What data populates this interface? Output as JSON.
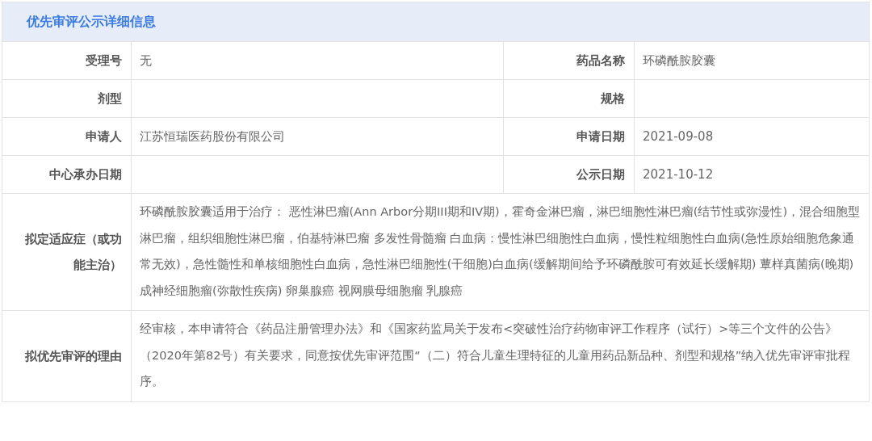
{
  "title": "优先审评公示详细信息",
  "pair_rows": [
    {
      "fields": [
        {
          "label": "受理号",
          "value": "无"
        },
        {
          "label": "药品名称",
          "value": "环磷酰胺胶囊"
        }
      ]
    },
    {
      "fields": [
        {
          "label": "剂型"
        },
        {
          "label": "规格"
        }
      ]
    },
    {
      "fields": [
        {
          "label": "申请人",
          "value": "江苏恒瑞医药股份有限公司"
        },
        {
          "label": "申请日期",
          "value": "2021-09-08"
        }
      ]
    },
    {
      "fields": [
        {
          "label": "中心承办日期"
        },
        {
          "label": "公示日期",
          "value": "2021-10-12"
        }
      ]
    }
  ],
  "long_rows": [
    {
      "label": "拟定适应症（或功能主治）",
      "value": "环磷酰胺胶囊适用于治疗： 恶性淋巴瘤(Ann Arbor分期III期和IV期)，霍奇金淋巴瘤，淋巴细胞性淋巴瘤(结节性或弥漫性)，混合细胞型淋巴瘤，组织细胞性淋巴瘤，伯基特淋巴瘤 多发性骨髓瘤 白血病：慢性淋巴细胞性白血病，慢性粒细胞性白血病(急性原始细胞危象通常无效)，急性髓性和单核细胞性白血病，急性淋巴细胞性(干细胞)白血病(缓解期间给予环磷酰胺可有效延长缓解期) 蕈样真菌病(晚期) 成神经细胞瘤(弥散性疾病) 卵巢腺癌 视网膜母细胞瘤 乳腺癌"
    },
    {
      "label": "拟优先审评的理由",
      "value": "经审核，本申请符合《药品注册管理办法》和《国家药监局关于发布<突破性治疗药物审评工作程序（试行）>等三个文件的公告》（2020年第82号）有关要求，同意按优先审评范围“（二）符合儿童生理特征的儿童用药品新品种、剂型和规格”纳入优先审评审批程序。"
    }
  ]
}
